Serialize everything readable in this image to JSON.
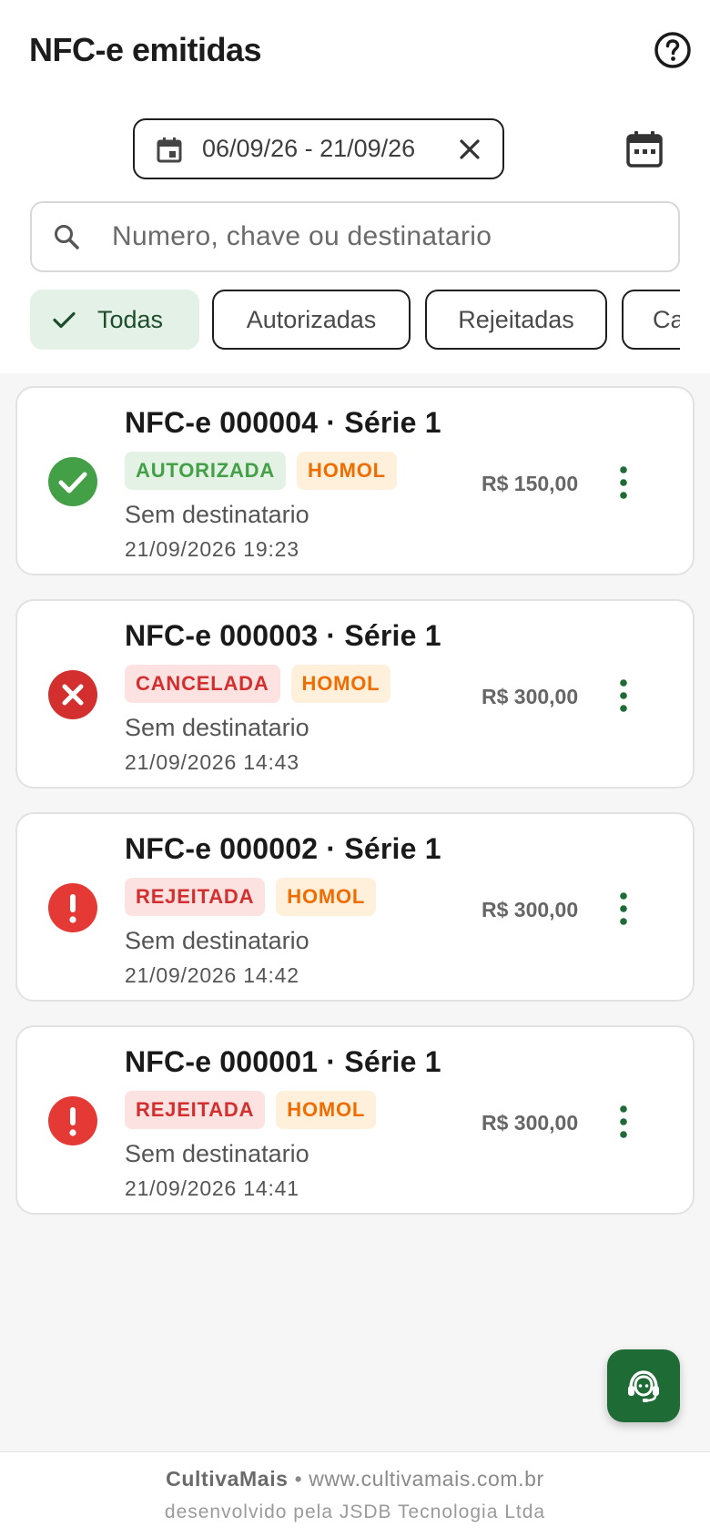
{
  "header": {
    "title": "NFC-e emitidas",
    "help_icon": "help-circle-icon"
  },
  "date_filter": {
    "range": "06/09/26 - 21/09/26",
    "icon": "calendar-small-icon",
    "clear_icon": "close-icon",
    "picker_icon": "calendar-icon"
  },
  "search": {
    "placeholder": "Numero, chave ou destinatario",
    "icon": "search-icon"
  },
  "filters": [
    {
      "label": "Todas",
      "active": true
    },
    {
      "label": "Autorizadas",
      "active": false
    },
    {
      "label": "Rejeitadas",
      "active": false
    },
    {
      "label": "Ca",
      "active": false
    }
  ],
  "invoices": [
    {
      "title": "NFC-e 000004 · Série 1",
      "status": "AUTORIZADA",
      "environment": "HOMOL",
      "recipient": "Sem destinatario",
      "datetime": "21/09/2026 19:23",
      "amount": "R$ 150,00",
      "status_icon": "check-circle-icon"
    },
    {
      "title": "NFC-e 000003 · Série 1",
      "status": "CANCELADA",
      "environment": "HOMOL",
      "recipient": "Sem destinatario",
      "datetime": "21/09/2026 14:43",
      "amount": "R$ 300,00",
      "status_icon": "cancel-circle-icon"
    },
    {
      "title": "NFC-e 000002 · Série 1",
      "status": "REJEITADA",
      "environment": "HOMOL",
      "recipient": "Sem destinatario",
      "datetime": "21/09/2026 14:42",
      "amount": "R$ 300,00",
      "status_icon": "error-circle-icon"
    },
    {
      "title": "NFC-e 000001 · Série 1",
      "status": "REJEITADA",
      "environment": "HOMOL",
      "recipient": "Sem destinatario",
      "datetime": "21/09/2026 14:41",
      "amount": "R$ 300,00",
      "status_icon": "error-circle-icon"
    }
  ],
  "fab": {
    "icon": "support-agent-icon"
  },
  "footer": {
    "brand": "CultivaMais",
    "separator": "•",
    "site": "www.cultivamais.com.br",
    "developer": "desenvolvido pela JSDB Tecnologia Ltda"
  },
  "colors": {
    "accent_green": "#1e6b35",
    "success": "#43a047",
    "error": "#e53935",
    "cancel": "#d32f2f",
    "homol": "#ef6c00",
    "chip_active_bg": "#e3f1e6"
  }
}
